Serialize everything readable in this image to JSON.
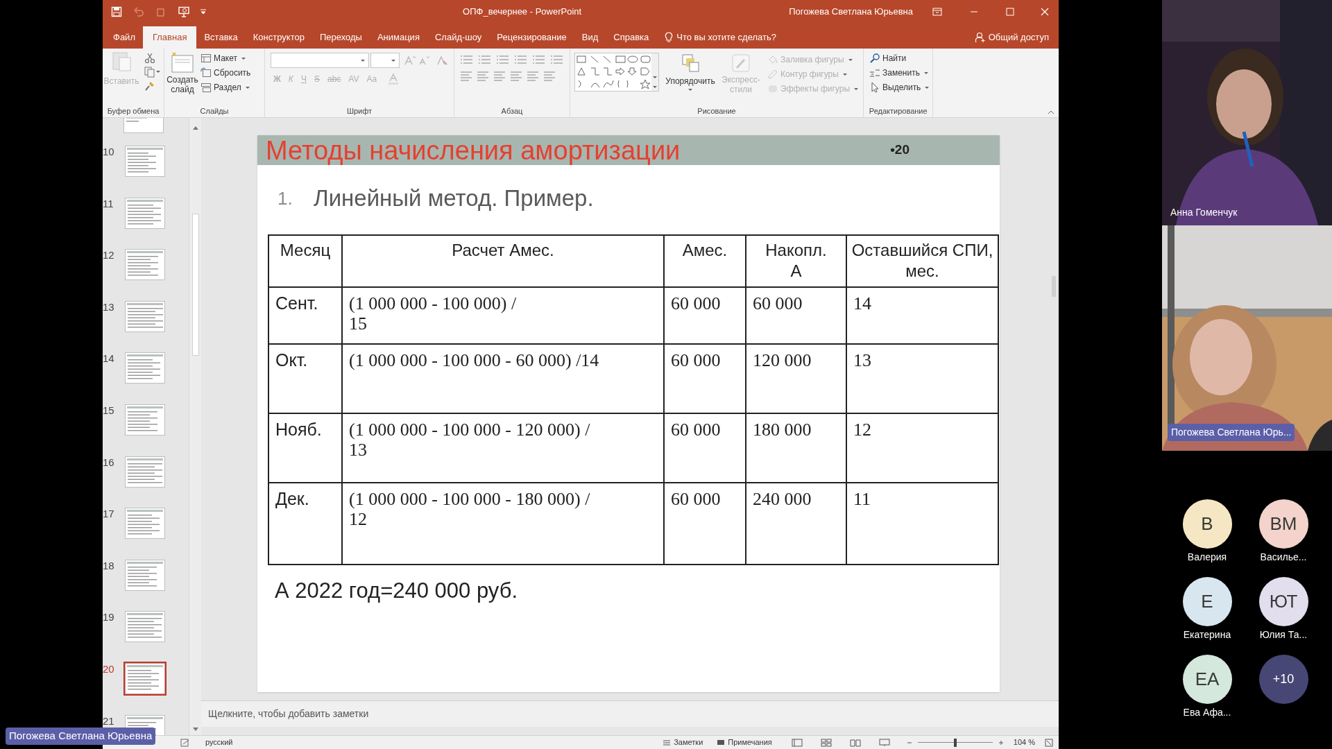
{
  "window": {
    "title": "ОПФ_вечернее - PowerPoint",
    "user": "Погожева Светлана Юрьевна"
  },
  "ribbon_tabs": [
    {
      "label": "Файл",
      "selected": false
    },
    {
      "label": "Главная",
      "selected": true
    },
    {
      "label": "Вставка",
      "selected": false
    },
    {
      "label": "Конструктор",
      "selected": false
    },
    {
      "label": "Переходы",
      "selected": false
    },
    {
      "label": "Анимация",
      "selected": false
    },
    {
      "label": "Слайд-шоу",
      "selected": false
    },
    {
      "label": "Рецензирование",
      "selected": false
    },
    {
      "label": "Вид",
      "selected": false
    },
    {
      "label": "Справка",
      "selected": false
    }
  ],
  "tell_me": "Что вы хотите сделать?",
  "share": "Общий доступ",
  "ribbon": {
    "clipboard": {
      "label": "Буфер обмена",
      "paste": {
        "label": "Вставить",
        "disabled": true
      }
    },
    "slides": {
      "label": "Слайды",
      "new_slide": "Создать\nслайд",
      "commands": [
        {
          "label": "Макет",
          "disabled": false
        },
        {
          "label": "Сбросить",
          "disabled": false
        },
        {
          "label": "Раздел",
          "disabled": false
        }
      ]
    },
    "font": {
      "label": "Шрифт",
      "buttons": [
        {
          "label": "Ж",
          "disabled": true
        },
        {
          "label": "К",
          "disabled": true
        },
        {
          "label": "Ч",
          "disabled": true
        },
        {
          "label": "S",
          "disabled": true
        },
        {
          "label": "abc",
          "disabled": true
        },
        {
          "label": "AV",
          "disabled": true
        },
        {
          "label": "Aa",
          "disabled": true
        }
      ]
    },
    "paragraph": {
      "label": "Абзац"
    },
    "drawing": {
      "label": "Рисование",
      "arrange": "Упорядочить",
      "quick_styles": {
        "label": "Экспресс-\nстили",
        "disabled": true
      },
      "shape_commands": [
        {
          "label": "Заливка фигуры",
          "disabled": true
        },
        {
          "label": "Контур фигуры",
          "disabled": true
        },
        {
          "label": "Эффекты фигуры",
          "disabled": true
        }
      ]
    },
    "editing": {
      "label": "Редактирование",
      "commands": [
        {
          "label": "Найти",
          "disabled": false
        },
        {
          "label": "Заменить",
          "disabled": false
        },
        {
          "label": "Выделить",
          "disabled": false
        }
      ]
    }
  },
  "thumbnails": [
    {
      "number": "10",
      "selected": false
    },
    {
      "number": "11",
      "selected": false
    },
    {
      "number": "12",
      "selected": false
    },
    {
      "number": "13",
      "selected": false
    },
    {
      "number": "14",
      "selected": false
    },
    {
      "number": "15",
      "selected": false
    },
    {
      "number": "16",
      "selected": false
    },
    {
      "number": "17",
      "selected": false
    },
    {
      "number": "18",
      "selected": false
    },
    {
      "number": "19",
      "selected": false
    },
    {
      "number": "20",
      "selected": true
    },
    {
      "number": "21",
      "selected": false
    }
  ],
  "slide": {
    "title": "Методы начисления амортизации",
    "number": "•20",
    "list_number": "1.",
    "subtitle": "Линейный метод. Пример.",
    "table": {
      "columns": [
        "Месяц",
        "Расчет Амес.",
        "Амес.",
        "Накопл.\nА",
        "Оставшийся СПИ, мес."
      ],
      "rows": [
        [
          "Сент.",
          "(1 000 000 - 100 000) /\n15",
          "60 000",
          "60 000",
          "14"
        ],
        [
          "Окт.",
          "(1 000 000 - 100 000 - 60 000) /14",
          "60 000",
          "120 000",
          "13"
        ],
        [
          "Нояб.",
          "(1 000 000 - 100 000 - 120 000) /\n13",
          "60 000",
          "180 000",
          "12"
        ],
        [
          "Дек.",
          "(1 000 000 - 100 000 - 180 000) /\n12",
          "60 000",
          "240 000",
          "11"
        ]
      ]
    },
    "footer": "А 2022 год=240 000 руб."
  },
  "notes_placeholder": "Щелкните, чтобы добавить заметки",
  "status_bar": {
    "language": "русский",
    "notes": "Заметки",
    "comments": "Примечания",
    "zoom": "104 %",
    "zoom_slider": {
      "level": 0.5
    }
  },
  "presenter_label": "Погожева Светлана Юрьевна",
  "videos": [
    {
      "name": "Анна Гоменчук"
    },
    {
      "name": "Погожева Светлана Юрь..."
    }
  ],
  "participants": [
    {
      "initials": "В",
      "name": "Валерия",
      "color": "#f6e7c4"
    },
    {
      "initials": "ВМ",
      "name": "Василье...",
      "color": "#f3d3cb"
    },
    {
      "initials": "Е",
      "name": "Екатерина",
      "color": "#d8e6ef"
    },
    {
      "initials": "ЮТ",
      "name": "Юлия Та...",
      "color": "#e2deee"
    },
    {
      "initials": "ЕА",
      "name": "Ева Афа...",
      "color": "#d4e8dd"
    }
  ],
  "more_participants": "+10"
}
